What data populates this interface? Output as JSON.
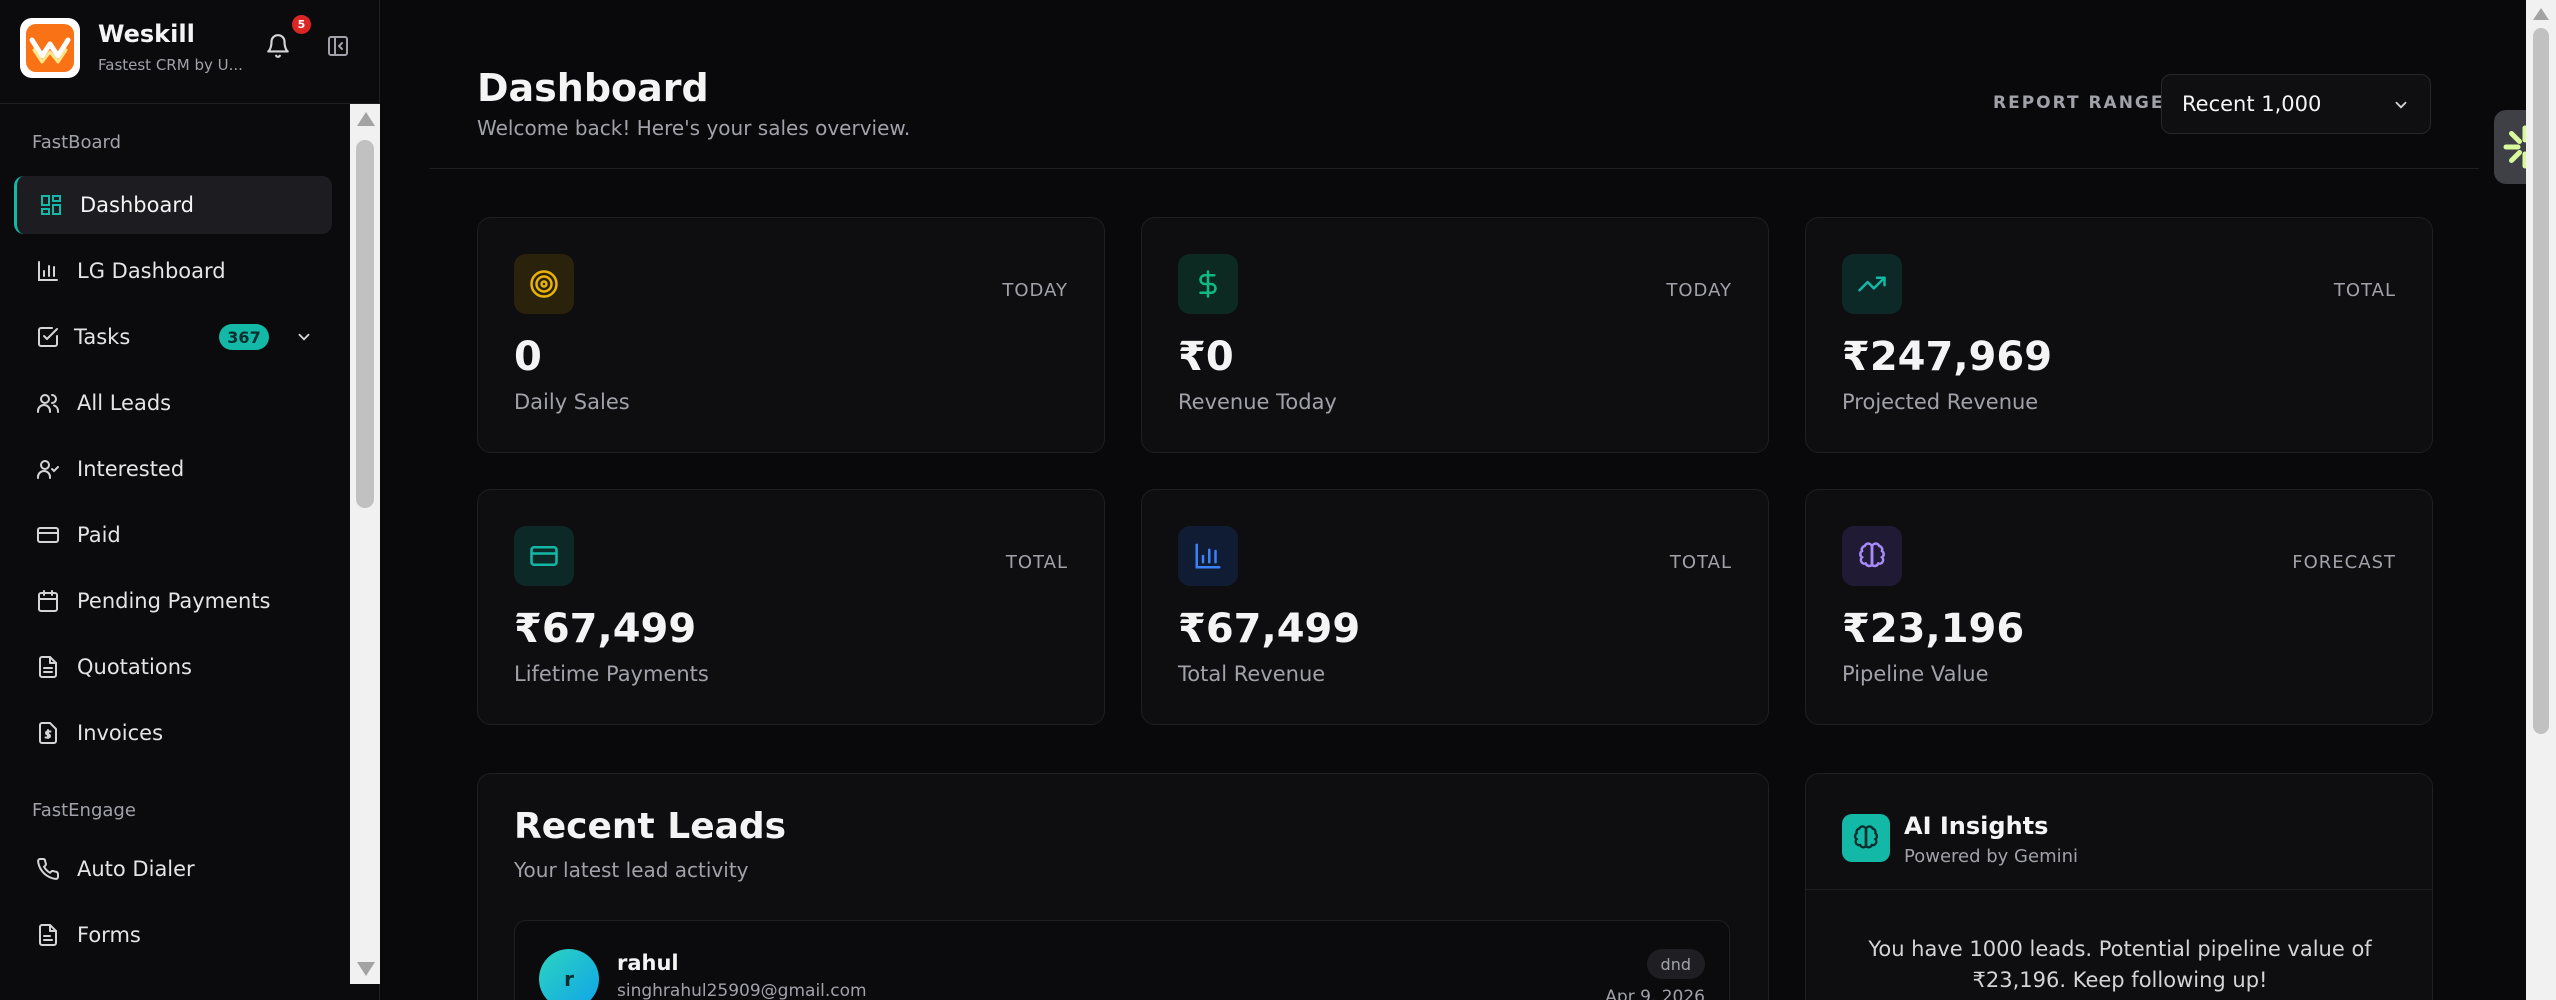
{
  "brand": {
    "name": "Weskill",
    "tagline": "Fastest CRM by U...",
    "notifications": "5"
  },
  "sidebar": {
    "sections": [
      {
        "title": "FastBoard"
      },
      {
        "title": "FastEngage"
      }
    ],
    "items": [
      {
        "label": "Dashboard",
        "icon": "grid-icon"
      },
      {
        "label": "LG Dashboard",
        "icon": "bar-chart-icon"
      },
      {
        "label": "Tasks",
        "icon": "checkbox-icon",
        "badge": "367"
      },
      {
        "label": "All Leads",
        "icon": "users-icon"
      },
      {
        "label": "Interested",
        "icon": "user-check-icon"
      },
      {
        "label": "Paid",
        "icon": "credit-card-icon"
      },
      {
        "label": "Pending Payments",
        "icon": "calendar-icon"
      },
      {
        "label": "Quotations",
        "icon": "document-icon"
      },
      {
        "label": "Invoices",
        "icon": "invoice-icon"
      },
      {
        "label": "Auto Dialer",
        "icon": "phone-icon"
      },
      {
        "label": "Forms",
        "icon": "form-icon"
      }
    ]
  },
  "header": {
    "title": "Dashboard",
    "subtitle": "Welcome back! Here's your sales overview.",
    "range_label": "REPORT RANGE:",
    "range_value": "Recent 1,000"
  },
  "stats": [
    {
      "tag": "TODAY",
      "value": "0",
      "label": "Daily Sales",
      "icon": "target-icon",
      "color": "#eab308"
    },
    {
      "tag": "TODAY",
      "value": "₹0",
      "label": "Revenue Today",
      "icon": "dollar-icon",
      "color": "#10b981"
    },
    {
      "tag": "TOTAL",
      "value": "₹247,969",
      "label": "Projected Revenue",
      "icon": "trending-up-icon",
      "color": "#14b8a6"
    },
    {
      "tag": "TOTAL",
      "value": "₹67,499",
      "label": "Lifetime Payments",
      "icon": "credit-card-icon",
      "color": "#14b8a6"
    },
    {
      "tag": "TOTAL",
      "value": "₹67,499",
      "label": "Total Revenue",
      "icon": "bar-chart-icon",
      "color": "#3b82f6"
    },
    {
      "tag": "FORECAST",
      "value": "₹23,196",
      "label": "Pipeline Value",
      "icon": "brain-icon",
      "color": "#a78bfa"
    }
  ],
  "recent_leads": {
    "title": "Recent Leads",
    "subtitle": "Your latest lead activity",
    "rows": [
      {
        "initial": "r",
        "name": "rahul",
        "email": "singhrahul25909@gmail.com",
        "status": "dnd",
        "date": "Apr 9, 2026"
      }
    ]
  },
  "ai_insights": {
    "title": "AI Insights",
    "subtitle": "Powered by Gemini",
    "text": "You have 1000 leads. Potential pipeline value of ₹23,196. Keep following up!"
  }
}
